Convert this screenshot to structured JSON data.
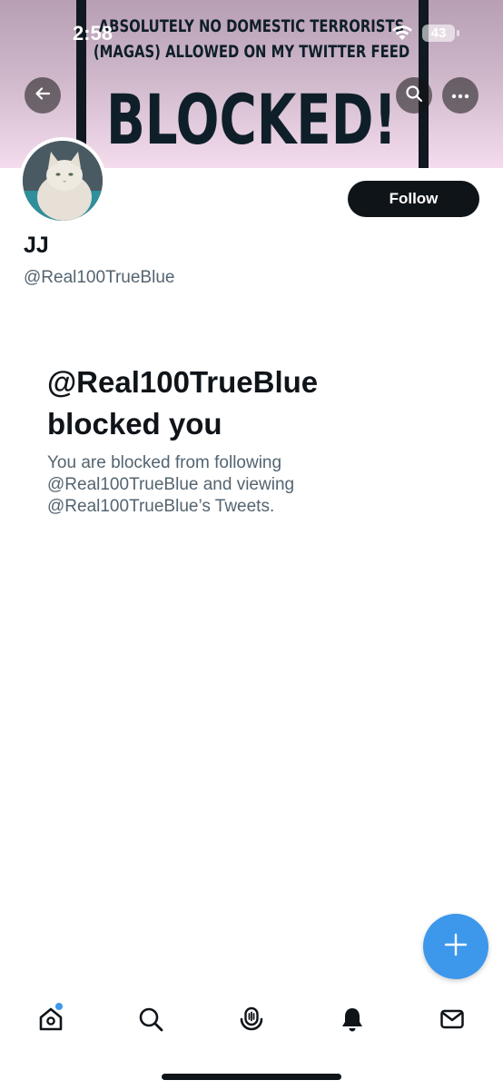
{
  "status_bar": {
    "time": "2:58",
    "battery": "43"
  },
  "banner": {
    "line1": "ABSOLUTELY NO DOMESTIC TERRORISTS",
    "line2": "(MAGAS) ALLOWED ON MY TWITTER FEED",
    "line3": "BLOCKED!"
  },
  "profile": {
    "display_name": "JJ",
    "handle": "@Real100TrueBlue",
    "follow_label": "Follow"
  },
  "blocked_notice": {
    "title": "@Real100TrueBlue blocked you",
    "description": "You are blocked from following @Real100TrueBlue and viewing @Real100TrueBlue’s Tweets."
  },
  "icons": {
    "back": "back-arrow-icon",
    "search": "search-icon",
    "more": "more-icon",
    "compose": "plus-icon",
    "nav": [
      "home-icon",
      "search-icon",
      "spaces-icon",
      "notifications-icon",
      "messages-icon"
    ]
  },
  "colors": {
    "accent": "#3d98eb",
    "text": "#0f1419",
    "secondary_text": "#536471"
  }
}
